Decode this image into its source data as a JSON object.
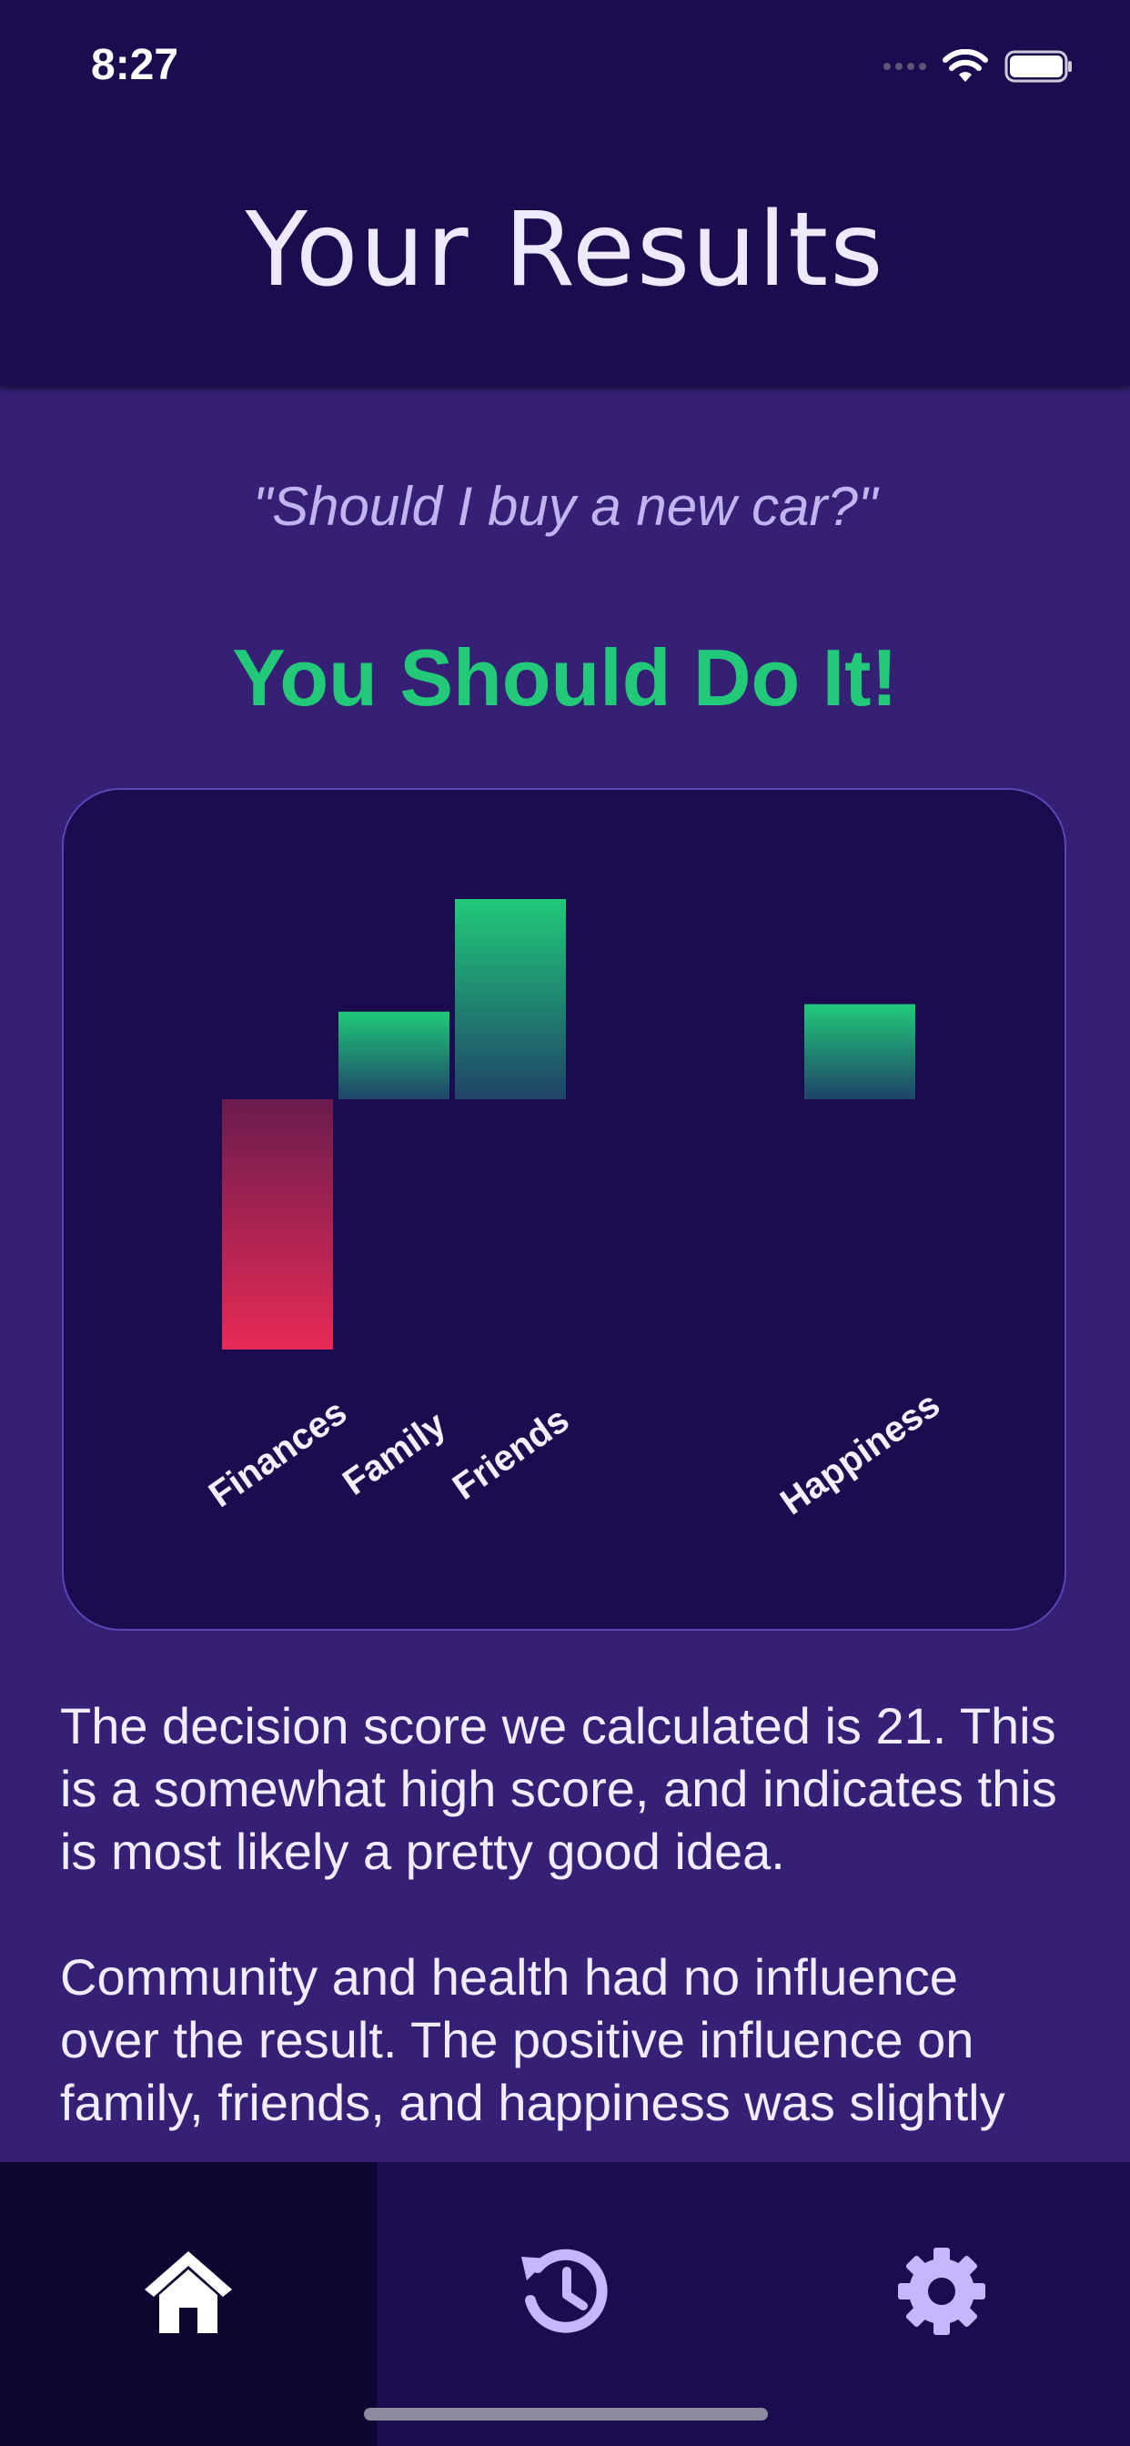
{
  "status_bar": {
    "time": "8:27",
    "signal_icon": "signal-icon",
    "wifi_icon": "wifi-icon",
    "battery_icon": "battery-icon"
  },
  "header": {
    "title": "Your Results"
  },
  "question": "\"Should I buy a new car?\"",
  "verdict": "You Should Do It!",
  "colors": {
    "positive": "#21c979",
    "negative": "#e82a55",
    "background": "#352076",
    "panel": "#1a0c4f",
    "accent": "#c7b6ff"
  },
  "chart_data": {
    "type": "bar",
    "categories": [
      "Finances",
      "Family",
      "Friends",
      "Community",
      "Health",
      "Happiness"
    ],
    "visible_labels": [
      "Finances",
      "Family",
      "Friends",
      "",
      "",
      "Happiness"
    ],
    "values": [
      -5,
      1.75,
      4,
      0,
      0,
      1.9
    ],
    "title": "",
    "xlabel": "",
    "ylabel": "",
    "grid": false,
    "legend": "none"
  },
  "summary": {
    "paragraph_1": "The decision score we calculated is 21. This is a somewhat high score, and indicates this is most likely a pretty good idea.",
    "paragraph_2": "Community and health had no influence over the result. The positive influence on family, friends, and happiness was slightly"
  },
  "tabbar": {
    "tabs": [
      {
        "icon": "home-icon",
        "active": true
      },
      {
        "icon": "history-icon",
        "active": false
      },
      {
        "icon": "settings-icon",
        "active": false
      }
    ]
  }
}
